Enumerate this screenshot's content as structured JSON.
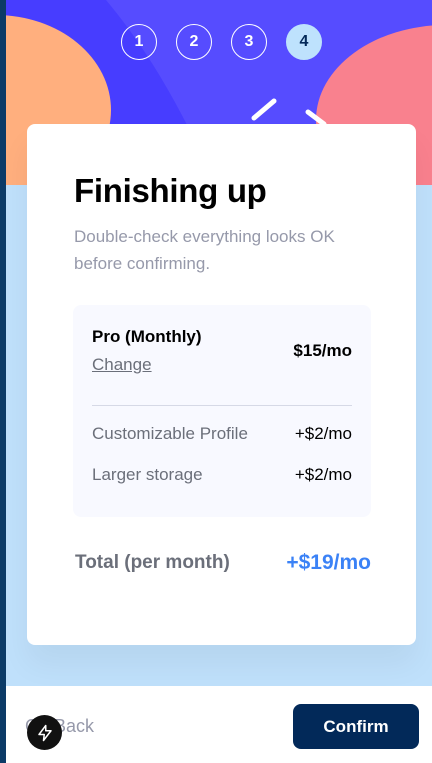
{
  "steps": [
    "1",
    "2",
    "3",
    "4"
  ],
  "active_step": 4,
  "card": {
    "title": "Finishing up",
    "subtitle": "Double-check everything looks OK before confirming."
  },
  "summary": {
    "plan_name": "Pro (Monthly)",
    "change_label": "Change",
    "plan_price": "$15/mo",
    "addons": [
      {
        "name": "Customizable Profile",
        "price": "+$2/mo"
      },
      {
        "name": "Larger storage",
        "price": "+$2/mo"
      }
    ]
  },
  "total": {
    "label": "Total (per month)",
    "value": "+$19/mo"
  },
  "footer": {
    "back_label": "Go Back",
    "confirm_label": "Confirm"
  },
  "icons": {
    "floating_badge": "lightning-bolt-icon"
  },
  "colors": {
    "header_bg": "#473dff",
    "accent": "#3b82f6",
    "primary_dark": "#022959",
    "page_bg": "#bfe0fb"
  }
}
